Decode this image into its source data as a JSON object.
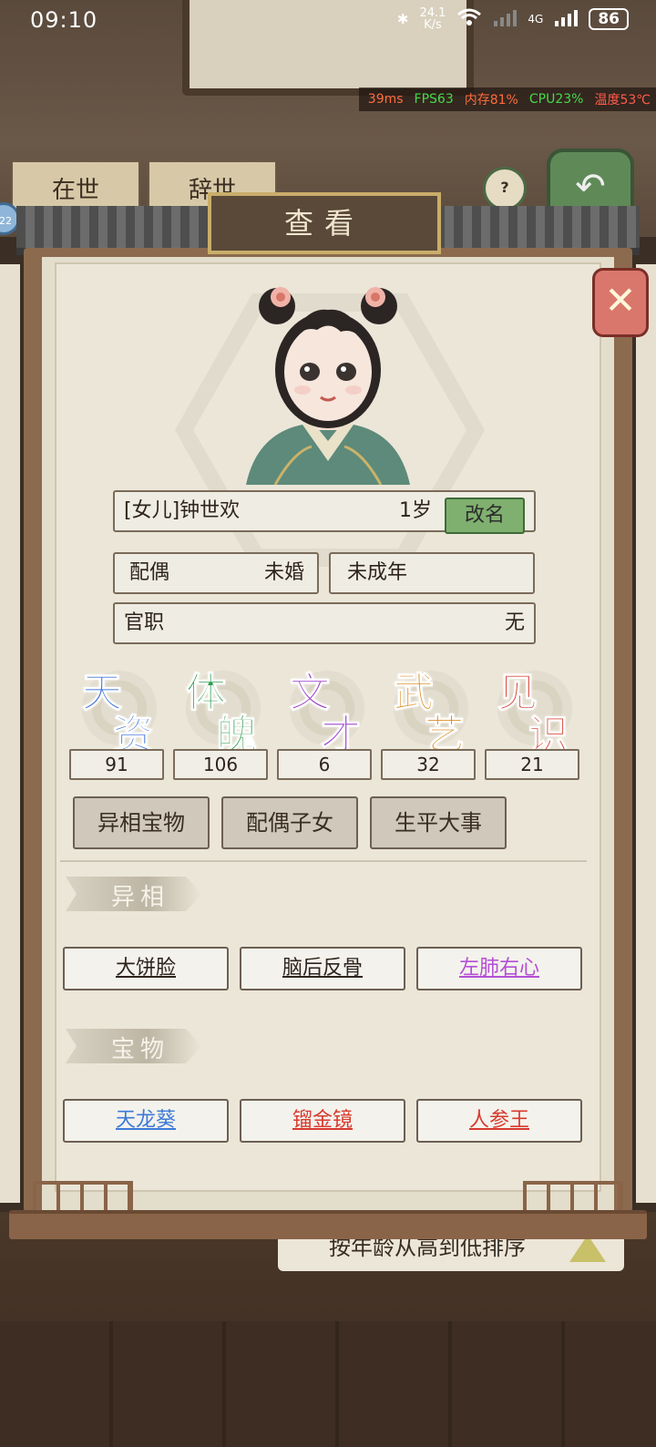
{
  "status_bar": {
    "time": "09:10",
    "net_speed_value": "24.1",
    "net_speed_unit": "K/s",
    "network": "4G",
    "battery": "86"
  },
  "perf_overlay": {
    "ping": "39ms",
    "fps": "FPS63",
    "memory": "内存81%",
    "cpu": "CPU23%",
    "temperature": "温度53℃"
  },
  "background": {
    "tab_alive": "在世",
    "tab_dead": "辞世",
    "help": "?",
    "sort_label": "按年龄从高到低排序",
    "badge": "22"
  },
  "dialog": {
    "title": "查看",
    "close": "✕"
  },
  "profile": {
    "name": "[女儿]钟世欢",
    "age": "1岁",
    "rename_label": "改名",
    "spouse_label": "配偶",
    "spouse_value": "未婚",
    "adult_status": "未成年",
    "office_label": "官职",
    "office_value": "无"
  },
  "attributes": [
    {
      "name_top": "天",
      "name_bottom": "资",
      "value": "91",
      "color": "#3d73d8"
    },
    {
      "name_top": "体",
      "name_bottom": "魄",
      "value": "106",
      "color": "#2f9b4d"
    },
    {
      "name_top": "文",
      "name_bottom": "才",
      "value": "6",
      "color": "#9b3fc8"
    },
    {
      "name_top": "武",
      "name_bottom": "艺",
      "value": "32",
      "color": "#d88a1e"
    },
    {
      "name_top": "见",
      "name_bottom": "识",
      "value": "21",
      "color": "#d84a3e"
    }
  ],
  "sub_tabs": [
    {
      "label": "异相宝物",
      "active": true
    },
    {
      "label": "配偶子女",
      "active": false
    },
    {
      "label": "生平大事",
      "active": false
    }
  ],
  "traits_section": {
    "title": "异相",
    "items": [
      {
        "label": "大饼脸",
        "color": "#2d241c"
      },
      {
        "label": "脑后反骨",
        "color": "#2d241c"
      },
      {
        "label": "左肺右心",
        "color": "#b44fd6"
      }
    ]
  },
  "treasures_section": {
    "title": "宝物",
    "items": [
      {
        "label": "天龙葵",
        "color": "#3d7ad8"
      },
      {
        "label": "镏金镜",
        "color": "#d83a2e"
      },
      {
        "label": "人参王",
        "color": "#d83a2e"
      }
    ]
  }
}
